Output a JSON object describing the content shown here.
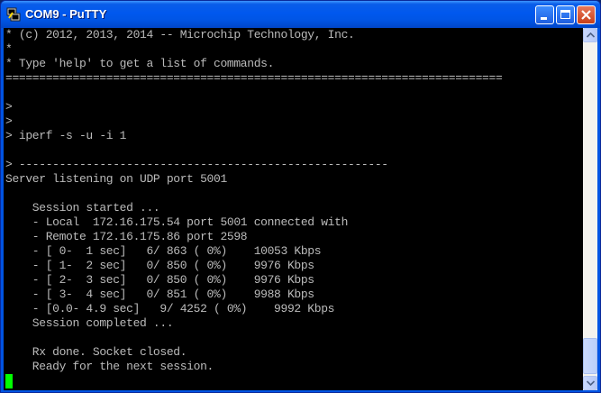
{
  "window": {
    "title": "COM9 - PuTTY",
    "accent_color": "#0054e3",
    "icons": [
      "putty-app-icon",
      "minimize-icon",
      "maximize-icon",
      "close-icon"
    ]
  },
  "terminal": {
    "background": "#000000",
    "foreground": "#bbbbbb",
    "cursor_color": "#00ff00",
    "lines": [
      "* (c) 2012, 2013, 2014 -- Microchip Technology, Inc.",
      "*",
      "* Type 'help' to get a list of commands.",
      "==========================================================================",
      "",
      "",
      ">",
      ">",
      "> iperf -s -u -i 1",
      "",
      "> -------------------------------------------------------",
      "Server listening on UDP port 5001",
      "",
      "    Session started ...",
      "    - Local  172.16.175.54 port 5001 connected with",
      "    - Remote 172.16.175.86 port 2598",
      "    - [ 0-  1 sec]   6/ 863 ( 0%)    10053 Kbps",
      "    - [ 1-  2 sec]   0/ 850 ( 0%)    9976 Kbps",
      "    - [ 2-  3 sec]   0/ 850 ( 0%)    9976 Kbps",
      "    - [ 3-  4 sec]   0/ 851 ( 0%)    9988 Kbps",
      "    - [0.0- 4.9 sec]   9/ 4252 ( 0%)    9992 Kbps",
      "    Session completed ...",
      "",
      "    Rx done. Socket closed.",
      "    Ready for the next session."
    ]
  },
  "scrollbar": {
    "position": "bottom"
  }
}
